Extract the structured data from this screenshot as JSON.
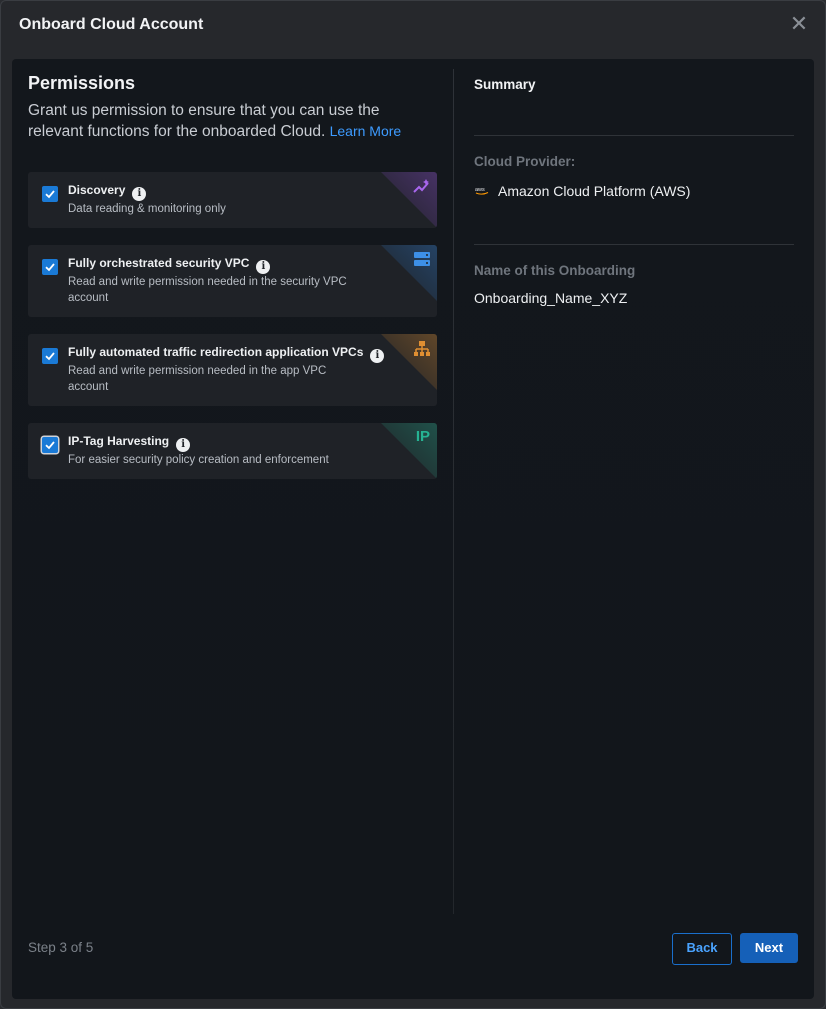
{
  "modal": {
    "title": "Onboard Cloud Account",
    "close_glyph": "✕"
  },
  "permissions": {
    "title": "Permissions",
    "description": "Grant us permission to ensure that you can use the relevant functions for the onboarded Cloud.",
    "learn_more": "Learn More",
    "items": [
      {
        "title": "Discovery",
        "description": "Data reading & monitoring only",
        "checked": true,
        "icon": "discovery-sparkle-icon",
        "accent": "#8f4fd6"
      },
      {
        "title": "Fully orchestrated security VPC",
        "description": "Read and write permission needed in the security VPC account",
        "checked": true,
        "icon": "server-stack-icon",
        "accent": "#2f7fd6"
      },
      {
        "title": "Fully automated traffic redirection application VPCs",
        "description": "Read and write permission needed in the app VPC account",
        "checked": true,
        "icon": "hierarchy-icon",
        "accent": "#d98a2e"
      },
      {
        "title": "IP-Tag Harvesting",
        "description": "For easier security policy creation and enforcement",
        "checked": true,
        "icon_text": "IP",
        "accent": "#23a88a"
      }
    ]
  },
  "summary": {
    "title": "Summary",
    "cloud_provider_label": "Cloud Provider:",
    "cloud_provider_value": "Amazon Cloud Platform (AWS)",
    "aws_icon_text": "aws",
    "onboarding_name_label": "Name of this Onboarding",
    "onboarding_name_value": "Onboarding_Name_XYZ"
  },
  "footer": {
    "step": "Step 3 of 5",
    "back_label": "Back",
    "next_label": "Next"
  }
}
